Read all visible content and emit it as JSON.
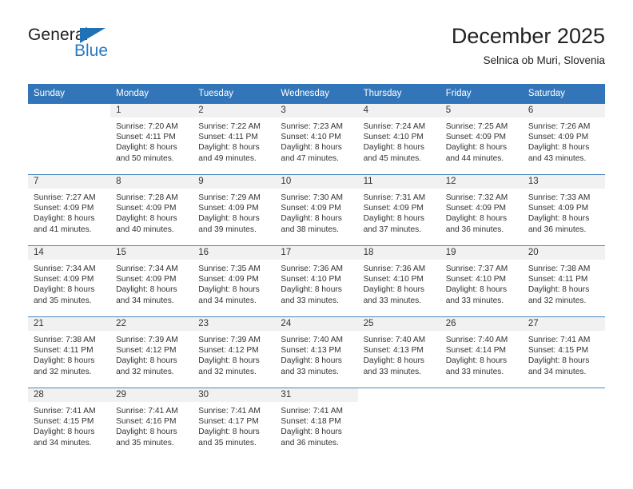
{
  "brand": {
    "name_part1": "General",
    "name_part2": "Blue",
    "triangle_color": "#1f72b5"
  },
  "header": {
    "title": "December 2025",
    "subtitle": "Selnica ob Muri, Slovenia"
  },
  "colors": {
    "header_blue": "#3275b8",
    "row_divider": "#4a86bd",
    "daynum_band": "#f1f1f1",
    "text": "#333333"
  },
  "weekday_headers": [
    "Sunday",
    "Monday",
    "Tuesday",
    "Wednesday",
    "Thursday",
    "Friday",
    "Saturday"
  ],
  "weeks": [
    [
      {
        "day": "",
        "blank": true
      },
      {
        "day": "1",
        "sunrise": "Sunrise: 7:20 AM",
        "sunset": "Sunset: 4:11 PM",
        "daylight1": "Daylight: 8 hours",
        "daylight2": "and 50 minutes."
      },
      {
        "day": "2",
        "sunrise": "Sunrise: 7:22 AM",
        "sunset": "Sunset: 4:11 PM",
        "daylight1": "Daylight: 8 hours",
        "daylight2": "and 49 minutes."
      },
      {
        "day": "3",
        "sunrise": "Sunrise: 7:23 AM",
        "sunset": "Sunset: 4:10 PM",
        "daylight1": "Daylight: 8 hours",
        "daylight2": "and 47 minutes."
      },
      {
        "day": "4",
        "sunrise": "Sunrise: 7:24 AM",
        "sunset": "Sunset: 4:10 PM",
        "daylight1": "Daylight: 8 hours",
        "daylight2": "and 45 minutes."
      },
      {
        "day": "5",
        "sunrise": "Sunrise: 7:25 AM",
        "sunset": "Sunset: 4:09 PM",
        "daylight1": "Daylight: 8 hours",
        "daylight2": "and 44 minutes."
      },
      {
        "day": "6",
        "sunrise": "Sunrise: 7:26 AM",
        "sunset": "Sunset: 4:09 PM",
        "daylight1": "Daylight: 8 hours",
        "daylight2": "and 43 minutes."
      }
    ],
    [
      {
        "day": "7",
        "sunrise": "Sunrise: 7:27 AM",
        "sunset": "Sunset: 4:09 PM",
        "daylight1": "Daylight: 8 hours",
        "daylight2": "and 41 minutes."
      },
      {
        "day": "8",
        "sunrise": "Sunrise: 7:28 AM",
        "sunset": "Sunset: 4:09 PM",
        "daylight1": "Daylight: 8 hours",
        "daylight2": "and 40 minutes."
      },
      {
        "day": "9",
        "sunrise": "Sunrise: 7:29 AM",
        "sunset": "Sunset: 4:09 PM",
        "daylight1": "Daylight: 8 hours",
        "daylight2": "and 39 minutes."
      },
      {
        "day": "10",
        "sunrise": "Sunrise: 7:30 AM",
        "sunset": "Sunset: 4:09 PM",
        "daylight1": "Daylight: 8 hours",
        "daylight2": "and 38 minutes."
      },
      {
        "day": "11",
        "sunrise": "Sunrise: 7:31 AM",
        "sunset": "Sunset: 4:09 PM",
        "daylight1": "Daylight: 8 hours",
        "daylight2": "and 37 minutes."
      },
      {
        "day": "12",
        "sunrise": "Sunrise: 7:32 AM",
        "sunset": "Sunset: 4:09 PM",
        "daylight1": "Daylight: 8 hours",
        "daylight2": "and 36 minutes."
      },
      {
        "day": "13",
        "sunrise": "Sunrise: 7:33 AM",
        "sunset": "Sunset: 4:09 PM",
        "daylight1": "Daylight: 8 hours",
        "daylight2": "and 36 minutes."
      }
    ],
    [
      {
        "day": "14",
        "sunrise": "Sunrise: 7:34 AM",
        "sunset": "Sunset: 4:09 PM",
        "daylight1": "Daylight: 8 hours",
        "daylight2": "and 35 minutes."
      },
      {
        "day": "15",
        "sunrise": "Sunrise: 7:34 AM",
        "sunset": "Sunset: 4:09 PM",
        "daylight1": "Daylight: 8 hours",
        "daylight2": "and 34 minutes."
      },
      {
        "day": "16",
        "sunrise": "Sunrise: 7:35 AM",
        "sunset": "Sunset: 4:09 PM",
        "daylight1": "Daylight: 8 hours",
        "daylight2": "and 34 minutes."
      },
      {
        "day": "17",
        "sunrise": "Sunrise: 7:36 AM",
        "sunset": "Sunset: 4:10 PM",
        "daylight1": "Daylight: 8 hours",
        "daylight2": "and 33 minutes."
      },
      {
        "day": "18",
        "sunrise": "Sunrise: 7:36 AM",
        "sunset": "Sunset: 4:10 PM",
        "daylight1": "Daylight: 8 hours",
        "daylight2": "and 33 minutes."
      },
      {
        "day": "19",
        "sunrise": "Sunrise: 7:37 AM",
        "sunset": "Sunset: 4:10 PM",
        "daylight1": "Daylight: 8 hours",
        "daylight2": "and 33 minutes."
      },
      {
        "day": "20",
        "sunrise": "Sunrise: 7:38 AM",
        "sunset": "Sunset: 4:11 PM",
        "daylight1": "Daylight: 8 hours",
        "daylight2": "and 32 minutes."
      }
    ],
    [
      {
        "day": "21",
        "sunrise": "Sunrise: 7:38 AM",
        "sunset": "Sunset: 4:11 PM",
        "daylight1": "Daylight: 8 hours",
        "daylight2": "and 32 minutes."
      },
      {
        "day": "22",
        "sunrise": "Sunrise: 7:39 AM",
        "sunset": "Sunset: 4:12 PM",
        "daylight1": "Daylight: 8 hours",
        "daylight2": "and 32 minutes."
      },
      {
        "day": "23",
        "sunrise": "Sunrise: 7:39 AM",
        "sunset": "Sunset: 4:12 PM",
        "daylight1": "Daylight: 8 hours",
        "daylight2": "and 32 minutes."
      },
      {
        "day": "24",
        "sunrise": "Sunrise: 7:40 AM",
        "sunset": "Sunset: 4:13 PM",
        "daylight1": "Daylight: 8 hours",
        "daylight2": "and 33 minutes."
      },
      {
        "day": "25",
        "sunrise": "Sunrise: 7:40 AM",
        "sunset": "Sunset: 4:13 PM",
        "daylight1": "Daylight: 8 hours",
        "daylight2": "and 33 minutes."
      },
      {
        "day": "26",
        "sunrise": "Sunrise: 7:40 AM",
        "sunset": "Sunset: 4:14 PM",
        "daylight1": "Daylight: 8 hours",
        "daylight2": "and 33 minutes."
      },
      {
        "day": "27",
        "sunrise": "Sunrise: 7:41 AM",
        "sunset": "Sunset: 4:15 PM",
        "daylight1": "Daylight: 8 hours",
        "daylight2": "and 34 minutes."
      }
    ],
    [
      {
        "day": "28",
        "sunrise": "Sunrise: 7:41 AM",
        "sunset": "Sunset: 4:15 PM",
        "daylight1": "Daylight: 8 hours",
        "daylight2": "and 34 minutes."
      },
      {
        "day": "29",
        "sunrise": "Sunrise: 7:41 AM",
        "sunset": "Sunset: 4:16 PM",
        "daylight1": "Daylight: 8 hours",
        "daylight2": "and 35 minutes."
      },
      {
        "day": "30",
        "sunrise": "Sunrise: 7:41 AM",
        "sunset": "Sunset: 4:17 PM",
        "daylight1": "Daylight: 8 hours",
        "daylight2": "and 35 minutes."
      },
      {
        "day": "31",
        "sunrise": "Sunrise: 7:41 AM",
        "sunset": "Sunset: 4:18 PM",
        "daylight1": "Daylight: 8 hours",
        "daylight2": "and 36 minutes."
      },
      {
        "day": "",
        "blank": true
      },
      {
        "day": "",
        "blank": true
      },
      {
        "day": "",
        "blank": true
      }
    ]
  ]
}
